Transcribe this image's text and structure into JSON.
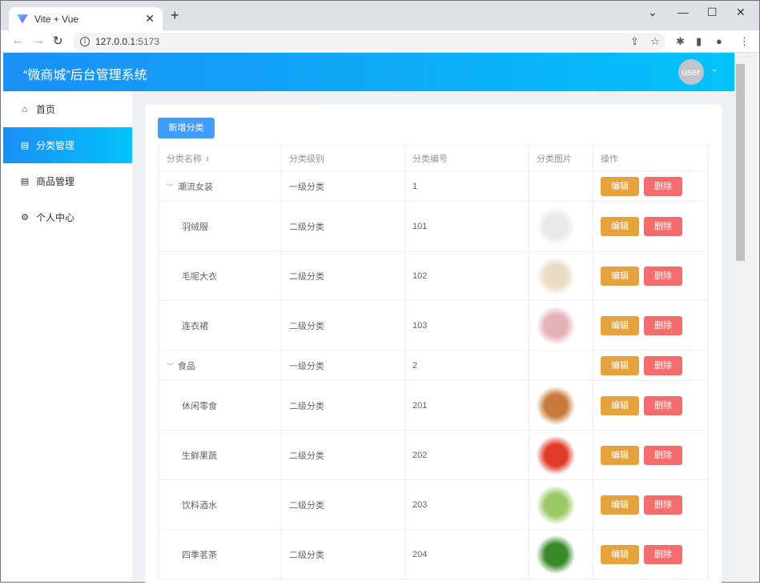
{
  "browser": {
    "tab_title": "Vite + Vue",
    "url_host": "127.0.0.1",
    "url_port": ":5173"
  },
  "header": {
    "title": "“微商城”后台管理系统",
    "user": "user"
  },
  "sidebar": {
    "items": [
      {
        "label": "首页",
        "icon": "home-icon"
      },
      {
        "label": "分类管理",
        "icon": "clipboard-icon"
      },
      {
        "label": "商品管理",
        "icon": "clipboard-icon"
      },
      {
        "label": "个人中心",
        "icon": "gear-icon"
      }
    ],
    "active": 1
  },
  "toolbar": {
    "add_label": "新增分类"
  },
  "table": {
    "headers": [
      "分类名称",
      "分类级别",
      "分类编号",
      "分类图片",
      "操作"
    ],
    "edit_label": "编辑",
    "delete_label": "删除",
    "rows": [
      {
        "name": "潮流女装",
        "level": "一级分类",
        "code": "1",
        "top": true
      },
      {
        "name": "羽绒服",
        "level": "二级分类",
        "code": "101",
        "img": "#e8e8e8"
      },
      {
        "name": "毛呢大衣",
        "level": "二级分类",
        "code": "102",
        "img": "#eadcc4"
      },
      {
        "name": "连衣裙",
        "level": "二级分类",
        "code": "103",
        "img": "#e6b0b8"
      },
      {
        "name": "食品",
        "level": "一级分类",
        "code": "2",
        "top": true
      },
      {
        "name": "休闲零食",
        "level": "二级分类",
        "code": "201",
        "img": "#c87a3a"
      },
      {
        "name": "生鲜果蔬",
        "level": "二级分类",
        "code": "202",
        "img": "#e03a2a"
      },
      {
        "name": "饮料酒水",
        "level": "二级分类",
        "code": "203",
        "img": "#9cc864"
      },
      {
        "name": "四季茗茶",
        "level": "二级分类",
        "code": "204",
        "img": "#3a8a2a"
      }
    ]
  }
}
